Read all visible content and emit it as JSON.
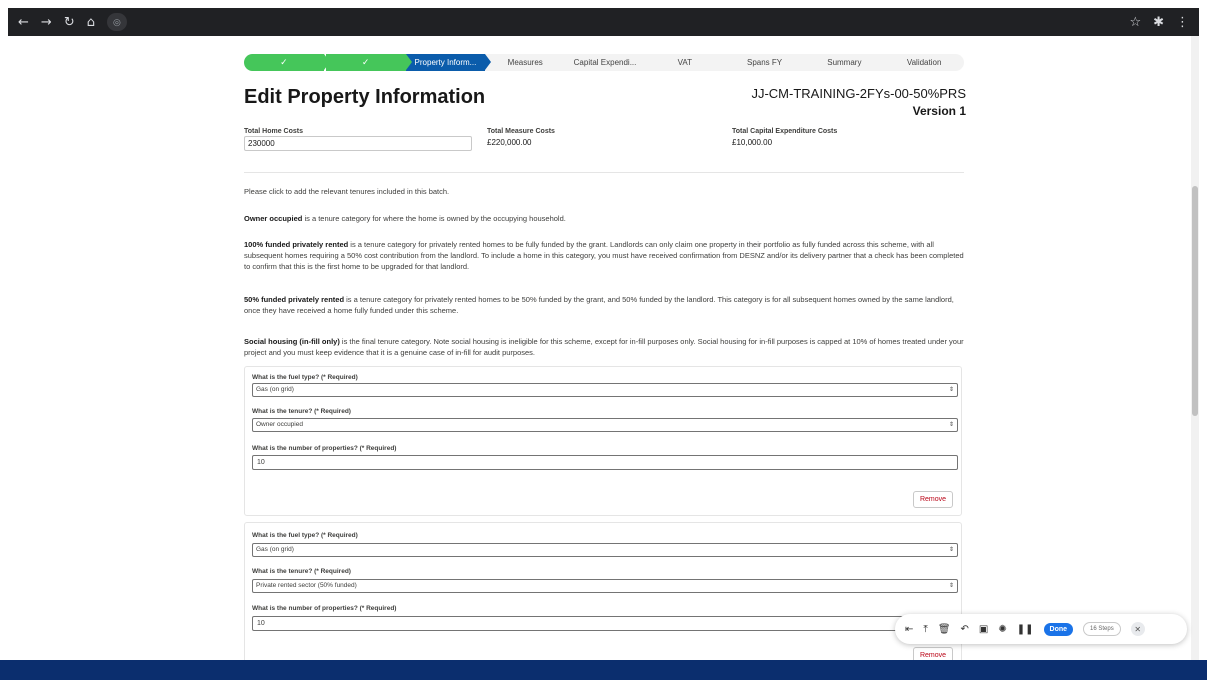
{
  "browser": {
    "back_icon": "arrow-left-icon",
    "forward_icon": "arrow-right-icon",
    "reload_icon": "reload-icon",
    "home_icon": "home-icon",
    "star_icon": "star-icon",
    "extension_icon": "puzzle-icon",
    "menu_icon": "kebab-icon"
  },
  "path": {
    "steps": [
      {
        "label": "✓",
        "state": "done"
      },
      {
        "label": "✓",
        "state": "done"
      },
      {
        "label": "Property Inform...",
        "state": "current"
      },
      {
        "label": "Measures",
        "state": "pending"
      },
      {
        "label": "Capital Expendi...",
        "state": "pending"
      },
      {
        "label": "VAT",
        "state": "pending"
      },
      {
        "label": "Spans FY",
        "state": "pending"
      },
      {
        "label": "Summary",
        "state": "pending"
      },
      {
        "label": "Validation",
        "state": "pending"
      }
    ]
  },
  "header": {
    "title": "Edit Property Information",
    "record_name": "JJ-CM-TRAINING-2FYs-00-50%PRS",
    "version": "Version 1"
  },
  "costs": {
    "home_label": "Total Home Costs",
    "home_value": "230000",
    "measure_label": "Total Measure Costs",
    "measure_value": "£220,000.00",
    "capex_label": "Total Capital Expenditure Costs",
    "capex_value": "£10,000.00"
  },
  "info": {
    "intro": "Please click to add the relevant tenures included in this batch.",
    "owner_bold": "Owner occupied",
    "owner_text": " is a tenure category for where the home is owned by the occupying household.",
    "prs100_bold": "100% funded privately rented",
    "prs100_text": " is a tenure category for privately rented homes to be fully funded by the grant. Landlords can only claim one property in their portfolio as fully funded across this scheme, with all subsequent homes requiring a 50% cost contribution from the landlord. To include a home in this category, you must have received confirmation from DESNZ and/or its delivery partner that a check has been completed to confirm that this is the first home to be upgraded for that landlord.",
    "prs50_bold": "50% funded privately rented",
    "prs50_text": " is a tenure category for privately rented homes to be 50% funded by the grant, and 50% funded by the landlord. This category is for all subsequent homes owned by the same landlord, once they have received a home fully funded under this scheme.",
    "social_bold": "Social housing (in-fill only)",
    "social_text": " is the final tenure category. Note social housing is ineligible for this scheme, except for in-fill purposes only. Social housing for in-fill purposes is capped at 10% of homes treated under your project and you must keep evidence that it is a genuine case of in-fill for audit purposes."
  },
  "cards": [
    {
      "fuel_label": "What is the fuel type? (* Required)",
      "fuel_value": "Gas (on grid)",
      "tenure_label": "What is the tenure? (* Required)",
      "tenure_value": "Owner occupied",
      "count_label": "What is the number of properties? (* Required)",
      "count_value": "10",
      "remove_label": "Remove"
    },
    {
      "fuel_label": "What is the fuel type? (* Required)",
      "fuel_value": "Gas (on grid)",
      "tenure_label": "What is the tenure? (* Required)",
      "tenure_value": "Private rented sector (50% funded)",
      "count_label": "What is the number of properties? (* Required)",
      "count_value": "10",
      "remove_label": "Remove"
    }
  ],
  "recorder": {
    "done_label": "Done",
    "steps_label": "16 Steps"
  },
  "colors": {
    "path_done": "#45c65a",
    "path_current": "#0b5cab",
    "remove_text": "#ba0517",
    "bottom_bar": "#0b2e6e"
  }
}
